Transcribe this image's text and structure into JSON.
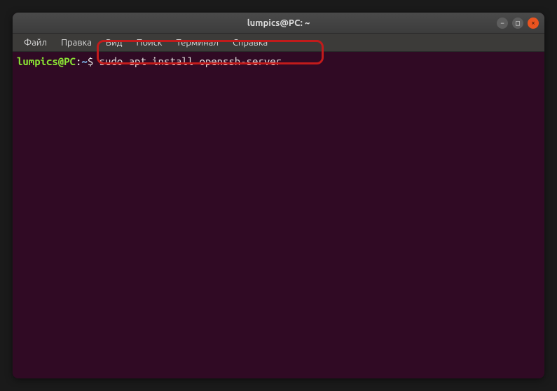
{
  "window": {
    "title": "lumpics@PC: ~"
  },
  "menu": {
    "file": "Файл",
    "edit": "Правка",
    "view": "Вид",
    "search": "Поиск",
    "terminal": "Терминал",
    "help": "Справка"
  },
  "prompt": {
    "user_host": "lumpics@PC",
    "colon": ":",
    "path": "~",
    "symbol": "$"
  },
  "command": "sudo apt install openssh-server",
  "controls": {
    "minimize": "−",
    "maximize": "□",
    "close": "×"
  }
}
